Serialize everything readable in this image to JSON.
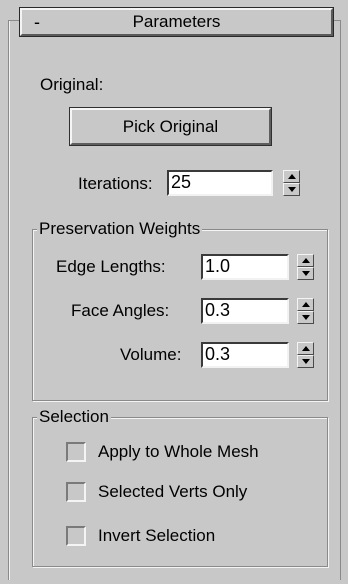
{
  "rollout": {
    "collapse_symbol": "-",
    "title": "Parameters"
  },
  "original": {
    "label": "Original:",
    "pick_button": "Pick Original"
  },
  "iterations": {
    "label": "Iterations:",
    "value": "25"
  },
  "preservation": {
    "title": "Preservation Weights",
    "edge_lengths": {
      "label": "Edge Lengths:",
      "value": "1.0"
    },
    "face_angles": {
      "label": "Face Angles:",
      "value": "0.3"
    },
    "volume": {
      "label": "Volume:",
      "value": "0.3"
    }
  },
  "selection": {
    "title": "Selection",
    "apply_whole_mesh": {
      "label": "Apply to Whole Mesh",
      "checked": false
    },
    "selected_verts_only": {
      "label": "Selected Verts Only",
      "checked": false
    },
    "invert_selection": {
      "label": "Invert Selection",
      "checked": false
    }
  },
  "colors": {
    "panel_bg": "#c8c8c8",
    "field_bg": "#ffffff"
  }
}
